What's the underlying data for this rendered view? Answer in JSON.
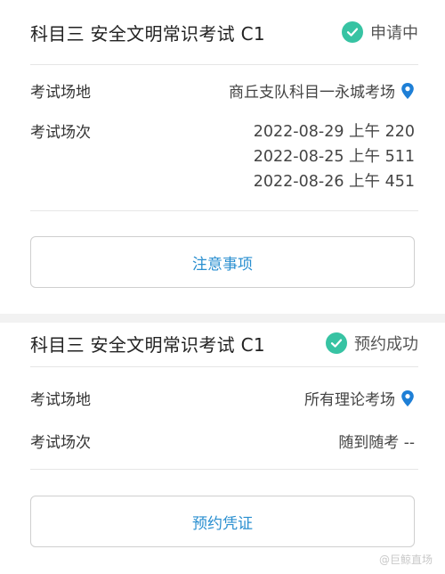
{
  "exams": [
    {
      "title": "科目三 安全文明常识考试 C1",
      "status": "申请中",
      "venue_label": "考试场地",
      "venue_value": "商丘支队科目一永城考场",
      "session_label": "考试场次",
      "sessions": [
        "2022-08-29 上午 220",
        "2022-08-25 上午 511",
        "2022-08-26 上午 451"
      ],
      "button_label": "注意事项"
    },
    {
      "title": "科目三 安全文明常识考试 C1",
      "status": "预约成功",
      "venue_label": "考试场地",
      "venue_value": "所有理论考场",
      "session_label": "考试场次",
      "session_value": "随到随考 --",
      "button_label": "预约凭证"
    }
  ],
  "watermark": "@巨鲸直场",
  "colors": {
    "accent_blue": "#2a8fd0",
    "status_green": "#37c3a3",
    "pin_blue": "#1e7fd6"
  }
}
